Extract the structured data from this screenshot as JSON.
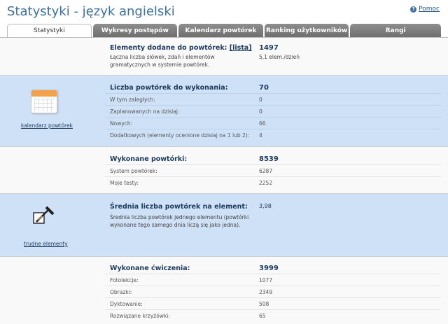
{
  "page": {
    "title": "Statystyki - język angielski",
    "help_label": "Pomoc",
    "help_icon": "help-circle-icon"
  },
  "tabs": [
    {
      "label": "Statystyki",
      "active": true
    },
    {
      "label": "Wykresy postępów",
      "active": false
    },
    {
      "label": "Kalendarz powtórek",
      "active": false
    },
    {
      "label": "Ranking użytkowników",
      "active": false
    },
    {
      "label": "Rangi",
      "active": false
    }
  ],
  "added": {
    "title": "Elementy dodane do powtórek:",
    "list_link": "[lista]",
    "value": "1497",
    "description": "Łączna liczba słówek, zdań i elementów gramatycznych w systemie powtórek.",
    "rate": "5,1 elem./dzień"
  },
  "todo": {
    "title": "Liczba powtórek do wykonania:",
    "value": "70",
    "side_link": "kalendarz powtórek",
    "icon": "calendar-icon",
    "rows": [
      {
        "label": "W tym zaległych:",
        "value": "0"
      },
      {
        "label": "Zaplanowanych na dzisiaj:",
        "value": "0"
      },
      {
        "label": "Nowych:",
        "value": "66"
      },
      {
        "label": "Dodatkowych (elementy ocenione dzisiaj na 1 lub 2):",
        "value": "4"
      }
    ]
  },
  "done": {
    "title": "Wykonane powtórki:",
    "value": "8539",
    "rows": [
      {
        "label": "System powtórek:",
        "value": "6287"
      },
      {
        "label": "Moje testy:",
        "value": "2252"
      }
    ]
  },
  "average": {
    "title": "Średnia liczba powtórek na element:",
    "value": "3,98",
    "description": "Średnia liczba powtórek jednego elementu (powtórki wykonane tego samego dnia liczą się jako jedna).",
    "side_link": "trudne elementy",
    "icon": "hammer-icon"
  },
  "exercises": {
    "title": "Wykonane ćwiczenia:",
    "value": "3999",
    "rows": [
      {
        "label": "Fotolekcje:",
        "value": "1077"
      },
      {
        "label": "Obrazki:",
        "value": "2349"
      },
      {
        "label": "Dyktowanie:",
        "value": "508"
      },
      {
        "label": "Rozwiązane krzyżówki:",
        "value": "65"
      }
    ]
  }
}
